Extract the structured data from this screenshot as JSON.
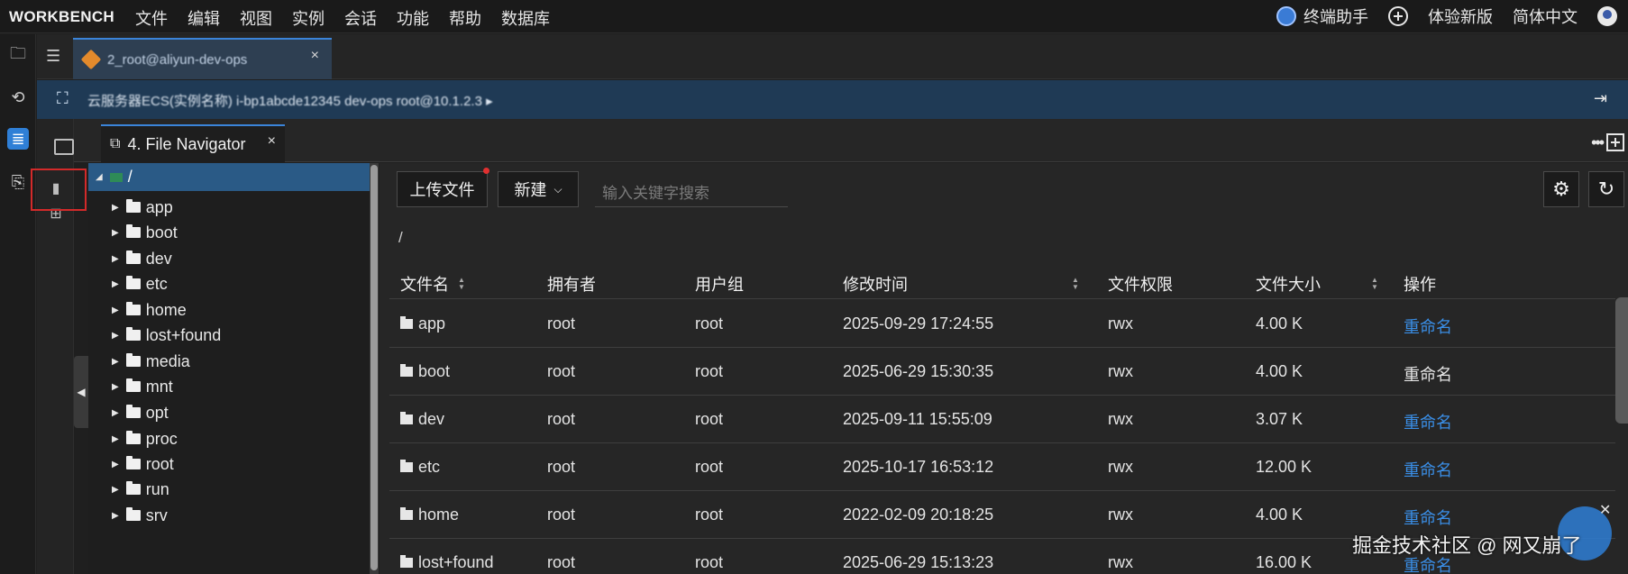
{
  "app": {
    "brand": "WORKBENCH",
    "menu": [
      "文件",
      "编辑",
      "视图",
      "实例",
      "会话",
      "功能",
      "帮助",
      "数据库"
    ],
    "top_right": {
      "terminal_assistant": "终端助手",
      "try_new": "体验新版",
      "language": "简体中文"
    }
  },
  "session_tab": {
    "label": "2_root@aliyun-dev-ops",
    "close": "×"
  },
  "info_bar": {
    "text": "云服务器ECS(实例名称) i-bp1abcde12345 dev-ops root@10.1.2.3 ▸"
  },
  "inner_tab": {
    "label": "4. File Navigator",
    "close": "×"
  },
  "tree": {
    "root": "/",
    "items": [
      "app",
      "boot",
      "dev",
      "etc",
      "home",
      "lost+found",
      "media",
      "mnt",
      "opt",
      "proc",
      "root",
      "run",
      "srv"
    ]
  },
  "toolbar": {
    "upload": "上传文件",
    "new": "新建",
    "search_placeholder": "输入关键字搜索"
  },
  "path": "/",
  "table": {
    "headers": [
      "文件名",
      "拥有者",
      "用户组",
      "修改时间",
      "文件权限",
      "文件大小",
      "操作"
    ],
    "rows": [
      {
        "name": "app",
        "owner": "root",
        "group": "root",
        "mtime": "2025-09-29 17:24:55",
        "perm": "rwx",
        "size": "4.00 K",
        "action": "重命名",
        "action_link": true
      },
      {
        "name": "boot",
        "owner": "root",
        "group": "root",
        "mtime": "2025-06-29 15:30:35",
        "perm": "rwx",
        "size": "4.00 K",
        "action": "重命名",
        "action_link": false
      },
      {
        "name": "dev",
        "owner": "root",
        "group": "root",
        "mtime": "2025-09-11 15:55:09",
        "perm": "rwx",
        "size": "3.07 K",
        "action": "重命名",
        "action_link": true
      },
      {
        "name": "etc",
        "owner": "root",
        "group": "root",
        "mtime": "2025-10-17 16:53:12",
        "perm": "rwx",
        "size": "12.00 K",
        "action": "重命名",
        "action_link": true
      },
      {
        "name": "home",
        "owner": "root",
        "group": "root",
        "mtime": "2022-02-09 20:18:25",
        "perm": "rwx",
        "size": "4.00 K",
        "action": "重命名",
        "action_link": true
      },
      {
        "name": "lost+found",
        "owner": "root",
        "group": "root",
        "mtime": "2025-06-29 15:13:23",
        "perm": "rwx",
        "size": "16.00 K",
        "action": "重命名",
        "action_link": true
      }
    ]
  },
  "watermark": "掘金技术社区 @ 网又崩了",
  "colors": {
    "accent": "#3a8ee6",
    "active_tree": "#2a5a86",
    "info_bar": "#1f3a55",
    "highlight_box": "#d32a2a"
  }
}
